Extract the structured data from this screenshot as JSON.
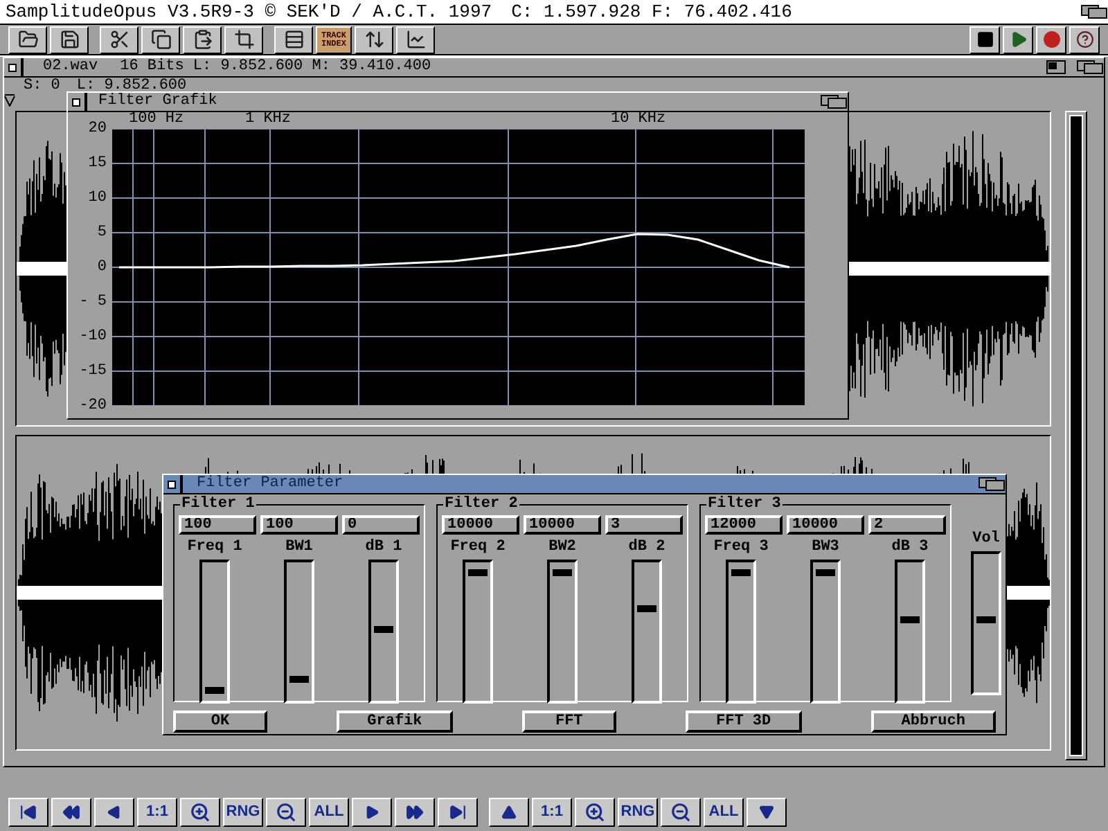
{
  "screen": {
    "title": "SamplitudeOpus V3.5R9-3 © SEK'D / A.C.T. 1997",
    "counters": "C: 1.597.928 F: 76.402.416"
  },
  "toolbar": {
    "track_index": [
      "TRACK",
      "INDEX"
    ]
  },
  "sample_window": {
    "file": "02.wav",
    "info": "16 Bits L: 9.852.600 M: 39.410.400",
    "start": "S: 0",
    "length": "L: 9.852.600"
  },
  "filter_graph": {
    "title": "Filter Grafik",
    "frequency_labels": [
      "100 Hz",
      "1 KHz",
      "10 KHz"
    ],
    "chart_data": {
      "type": "line",
      "grid": true,
      "ylim": [
        -20,
        20
      ],
      "yticks": [
        {
          "value": 20,
          "label": "20"
        },
        {
          "value": 15,
          "label": "15"
        },
        {
          "value": 10,
          "label": "10"
        },
        {
          "value": 5,
          "label": "5"
        },
        {
          "value": 0,
          "label": "0"
        },
        {
          "value": -5,
          "label": "- 5"
        },
        {
          "value": -10,
          "label": "-10"
        },
        {
          "value": -15,
          "label": "-15"
        },
        {
          "value": -20,
          "label": "-20"
        }
      ],
      "series": [
        {
          "color": "#ffffff",
          "values": [
            0,
            0,
            0,
            0,
            0.1,
            0.1,
            0.2,
            0.2,
            0.3,
            0.5,
            0.7,
            0.9,
            1.4,
            1.9,
            2.5,
            3.1,
            4,
            4.8,
            4.7,
            4,
            2.5,
            1,
            0
          ]
        }
      ]
    }
  },
  "filter_dialog": {
    "title": "Filter Parameter",
    "groups": [
      {
        "title": "Filter 1",
        "fields": [
          "100",
          "100",
          "0"
        ],
        "sliders": [
          {
            "label": "Freq 1",
            "level": 0.03
          },
          {
            "label": "BW1",
            "level": 0.12
          },
          {
            "label": "dB 1",
            "level": 0.52
          }
        ]
      },
      {
        "title": "Filter 2",
        "fields": [
          "10000",
          "10000",
          "3"
        ],
        "sliders": [
          {
            "label": "Freq 2",
            "level": 0.97
          },
          {
            "label": "BW2",
            "level": 0.97
          },
          {
            "label": "dB 2",
            "level": 0.68
          }
        ]
      },
      {
        "title": "Filter 3",
        "fields": [
          "12000",
          "10000",
          "2"
        ],
        "sliders": [
          {
            "label": "Freq 3",
            "level": 0.97
          },
          {
            "label": "BW3",
            "level": 0.97
          },
          {
            "label": "dB 3",
            "level": 0.59
          }
        ]
      }
    ],
    "volume": {
      "label": "Vol",
      "level": 0.53
    },
    "buttons": [
      "OK",
      "Grafik",
      "FFT",
      "FFT 3D",
      "Abbruch"
    ]
  },
  "bottom_toolbar": [
    {
      "kind": "icon"
    },
    {
      "kind": "icon"
    },
    {
      "kind": "icon"
    },
    {
      "kind": "text",
      "label": "1:1"
    },
    {
      "kind": "icon"
    },
    {
      "kind": "text",
      "label": "RNG"
    },
    {
      "kind": "icon"
    },
    {
      "kind": "text",
      "label": "ALL"
    },
    {
      "kind": "icon"
    },
    {
      "kind": "icon"
    },
    {
      "kind": "icon"
    },
    {
      "kind": "gap"
    },
    {
      "kind": "icon"
    },
    {
      "kind": "text",
      "label": "1:1"
    },
    {
      "kind": "icon"
    },
    {
      "kind": "text",
      "label": "RNG"
    },
    {
      "kind": "icon"
    },
    {
      "kind": "text",
      "label": "ALL"
    },
    {
      "kind": "icon"
    }
  ]
}
